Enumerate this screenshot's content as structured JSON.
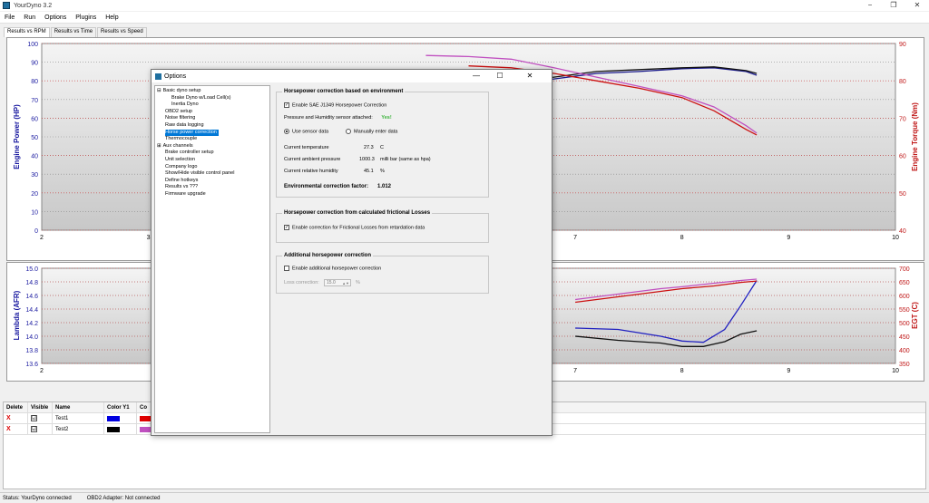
{
  "window": {
    "title": "YourDyno 3.2",
    "minimize": "−",
    "maximize": "❐",
    "close": "✕"
  },
  "menu": [
    "File",
    "Run",
    "Options",
    "Plugins",
    "Help"
  ],
  "tabs": [
    "Results vs RPM",
    "Results vs Time",
    "Results vs Speed"
  ],
  "top_chart": {
    "ylabel_left": "Engine Power (HP)",
    "ylabel_right": "Engine Torque (Nm)",
    "y_left_ticks": [
      "100",
      "90",
      "80",
      "70",
      "60",
      "50",
      "40",
      "30",
      "20",
      "10",
      "0"
    ],
    "y_right_ticks": [
      "90",
      "80",
      "70",
      "60",
      "50",
      "40"
    ],
    "x_ticks": [
      "2",
      "3",
      "7",
      "8",
      "9",
      "10"
    ]
  },
  "bottom_chart": {
    "ylabel_left": "Lambda (AFR)",
    "ylabel_right": "EGT (C)",
    "y_left_ticks": [
      "15.0",
      "14.8",
      "14.6",
      "14.4",
      "14.2",
      "14.0",
      "13.8",
      "13.6"
    ],
    "y_right_ticks": [
      "700",
      "650",
      "600",
      "550",
      "500",
      "450",
      "400",
      "350"
    ],
    "x_ticks": [
      "2",
      "7",
      "8",
      "9",
      "10"
    ]
  },
  "chart_data": [
    {
      "type": "line",
      "ylabel": "Engine Power (HP)",
      "xlim": [
        2,
        10
      ],
      "ylim": [
        0,
        100
      ],
      "y2lim": [
        40,
        90
      ],
      "grid": true,
      "series": [
        {
          "axis": "left",
          "color": "#1a1a8c",
          "x": [
            6.4,
            6.8,
            7.2,
            7.6,
            8.0,
            8.3,
            8.6,
            8.7
          ],
          "y": [
            79,
            81,
            84,
            85,
            86.5,
            87,
            85,
            83
          ]
        },
        {
          "axis": "left",
          "color": "#111111",
          "x": [
            6.4,
            6.8,
            7.2,
            7.6,
            8.0,
            8.3,
            8.6,
            8.7
          ],
          "y": [
            80,
            82,
            85,
            86,
            87,
            87.5,
            85.5,
            84
          ]
        },
        {
          "axis": "right",
          "color": "#cc1010",
          "x": [
            6.0,
            6.4,
            6.8,
            7.2,
            7.6,
            8.0,
            8.3,
            8.6,
            8.7
          ],
          "y": [
            84,
            83.5,
            82,
            80,
            78,
            75.5,
            72,
            67,
            65.5
          ]
        },
        {
          "axis": "right",
          "color": "#c050c0",
          "x": [
            5.6,
            6.0,
            6.4,
            6.8,
            7.2,
            7.6,
            8.0,
            8.3,
            8.6,
            8.7
          ],
          "y": [
            86.8,
            86.5,
            85.8,
            83.5,
            81,
            78.5,
            76,
            73,
            68,
            66
          ]
        }
      ]
    },
    {
      "type": "line",
      "ylabel": "Lambda (AFR)",
      "xlim": [
        2,
        10
      ],
      "ylim": [
        13.6,
        15.0
      ],
      "y2lim": [
        350,
        700
      ],
      "grid": true,
      "series": [
        {
          "axis": "left",
          "color": "#2020c0",
          "x": [
            7.0,
            7.4,
            7.8,
            8.0,
            8.2,
            8.4,
            8.55,
            8.7
          ],
          "y": [
            14.12,
            14.1,
            14.0,
            13.93,
            13.91,
            14.1,
            14.45,
            14.82
          ]
        },
        {
          "axis": "left",
          "color": "#111111",
          "x": [
            7.0,
            7.4,
            7.8,
            8.0,
            8.2,
            8.4,
            8.55,
            8.7
          ],
          "y": [
            14.0,
            13.94,
            13.9,
            13.85,
            13.85,
            13.92,
            14.03,
            14.08
          ]
        },
        {
          "axis": "right",
          "color": "#cc1010",
          "x": [
            7.0,
            7.4,
            7.8,
            8.0,
            8.3,
            8.55,
            8.7
          ],
          "y": [
            575,
            595,
            615,
            625,
            635,
            648,
            653
          ]
        },
        {
          "axis": "right",
          "color": "#c050c0",
          "x": [
            7.0,
            7.4,
            7.8,
            8.0,
            8.3,
            8.55,
            8.7
          ],
          "y": [
            585,
            605,
            625,
            632,
            645,
            655,
            660
          ]
        }
      ]
    }
  ],
  "table": {
    "headers": [
      "Delete",
      "Visible",
      "Name",
      "Color Y1",
      "Co"
    ],
    "rows": [
      {
        "delete": "X",
        "visible": "☑",
        "name": "Test1",
        "color_y1": "#0000e0",
        "color_y2": "#e00000"
      },
      {
        "delete": "X",
        "visible": "☑",
        "name": "Test2",
        "color_y1": "#000000",
        "color_y2": "#c050c0"
      }
    ]
  },
  "status": {
    "status": "Status: YourDyno connected",
    "obd": "OBD2 Adapter: Not connected"
  },
  "dialog": {
    "title": "Options",
    "minimize": "—",
    "maximize": "☐",
    "close": "✕",
    "tree": [
      {
        "label": "Basic dyno setup",
        "level": 0,
        "expander": "⊟"
      },
      {
        "label": "Brake Dyno w/Load Cell(s)",
        "level": 2
      },
      {
        "label": "Inertia Dyno",
        "level": 2
      },
      {
        "label": "OBD2 setup",
        "level": 1
      },
      {
        "label": "Noise filtering",
        "level": 1
      },
      {
        "label": "Raw data logging",
        "level": 1
      },
      {
        "label": "Horse power correction",
        "level": 1,
        "selected": true
      },
      {
        "label": "Thermocouple",
        "level": 1
      },
      {
        "label": "Aux channels",
        "level": 0,
        "expander": "⊞"
      },
      {
        "label": "Brake controller setup",
        "level": 1
      },
      {
        "label": "Unit selection",
        "level": 1
      },
      {
        "label": "Company logo",
        "level": 1
      },
      {
        "label": "Show/Hide visible control panel",
        "level": 1
      },
      {
        "label": "Define hotkeys",
        "level": 1
      },
      {
        "label": "Results vs ???",
        "level": 1
      },
      {
        "label": "Firmware upgrade",
        "level": 1
      }
    ],
    "env": {
      "title": "Horsepower correction based on environment",
      "enable_label": "Enable SAE J1349 Horsepower Correction",
      "sensor_label": "Pressure and Humidity sensor attached:",
      "sensor_value": "Yes!",
      "use_sensor": "Use sensor data",
      "manual": "Manually enter data",
      "temp_label": "Current temperature",
      "temp_value": "27.3",
      "temp_unit": "C",
      "pressure_label": "Current ambient pressure",
      "pressure_value": "1000.3",
      "pressure_unit": "milli bar (same as hpa)",
      "humidity_label": "Current relative humidity",
      "humidity_value": "45.1",
      "humidity_unit": "%",
      "factor_label": "Environmental correction factor:",
      "factor_value": "1.012"
    },
    "friction": {
      "title": "Horsepower correction from calculated frictional Losses",
      "enable_label": "Enable correction for Frictional Losses from retardation data"
    },
    "additional": {
      "title": "Additional horsepower correction",
      "enable_label": "Enable additional horsepower correction",
      "loss_label": "Loss correction:",
      "loss_value": "15.0",
      "loss_unit": "%"
    }
  }
}
